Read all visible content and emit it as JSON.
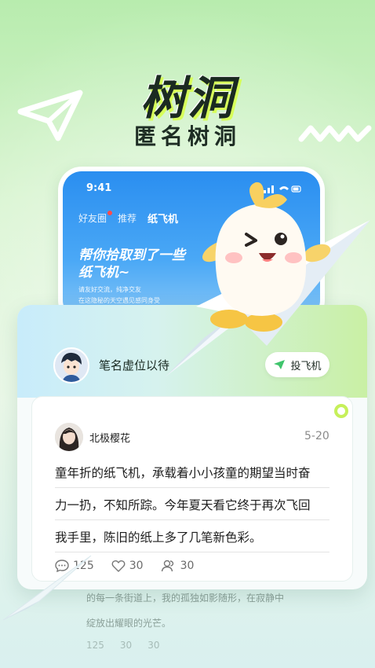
{
  "hero": {
    "title": "树洞",
    "subtitle": "匿名树洞"
  },
  "phone": {
    "status_time": "9:41",
    "tabs": [
      {
        "label": "好友圈",
        "has_dot": true
      },
      {
        "label": "推荐",
        "has_dot": false
      },
      {
        "label": "纸飞机",
        "active": true
      }
    ],
    "banner_heading_line1": "帮你拾取到了一些",
    "banner_heading_line2": "纸飞机~",
    "banner_sub_line1": "请友好交流，纯净交友",
    "banner_sub_line2": "在这隐秘的天空遇见感同身受"
  },
  "card": {
    "pen_name_placeholder": "笔名虚位以待",
    "throw_button_label": "投飞机",
    "post": {
      "author": "北极樱花",
      "date": "5-20",
      "lines": [
        "童年折的纸飞机，承载着小小孩童的期望当时奋",
        "力一扔，不知所踪。今年夏天看它终于再次飞回",
        "我手里，陈旧的纸上多了几笔新色彩。"
      ],
      "comments": "125",
      "likes": "30",
      "shares": "30"
    }
  },
  "faded_post": {
    "line1": "的每一条街道上，我的孤独如影随形，在寂静中",
    "line2": "绽放出耀眼的光芒。",
    "comments": "125",
    "likes": "30",
    "shares": "30"
  },
  "colors": {
    "accent_green": "#c7f25a",
    "phone_blue": "#2a8ef0",
    "notification_red": "#ff4b4b"
  }
}
